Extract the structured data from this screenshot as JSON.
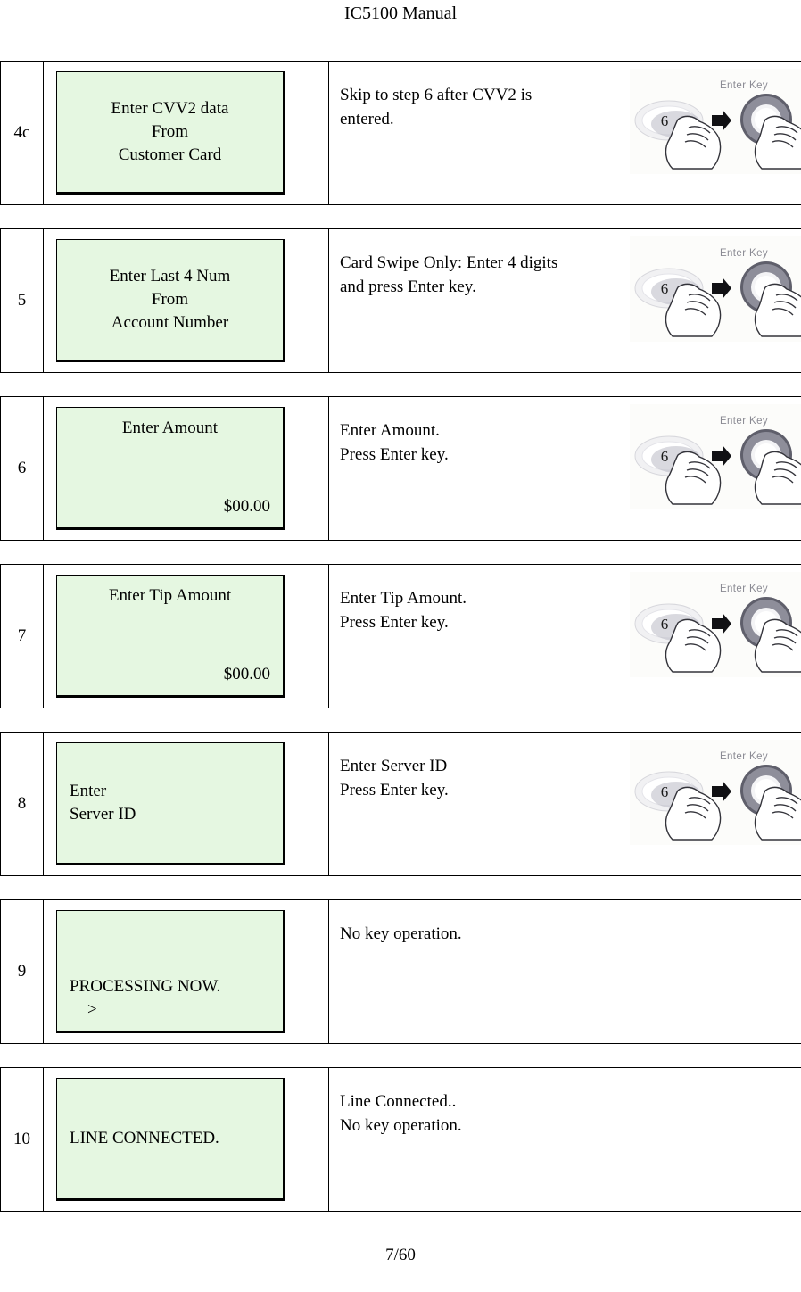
{
  "document": {
    "header_title": "IC5100 Manual",
    "footer_page": "7/60"
  },
  "icon_names": {
    "enter_key_figure": "enter-key-press-illustration",
    "numeric_key": "numeric-key-6-icon",
    "arrow": "right-arrow-icon",
    "enter_ring": "enter-key-ring-icon",
    "hand": "pointing-hand-icon"
  },
  "enter_key_graphic": {
    "label": "Enter Key",
    "key_digit": "6"
  },
  "colors": {
    "lcd_background": "#e5f7e1",
    "lcd_border": "#000000",
    "table_border": "#000000",
    "enter_key_label": "#8a8a93",
    "page_background": "#ffffff"
  },
  "steps": [
    {
      "number": "4c",
      "lcd": {
        "layout": "v-center",
        "lines": [
          {
            "text": "Enter CVV2 data",
            "align": "center"
          },
          {
            "text": "From",
            "align": "center"
          },
          {
            "text": "Customer Card",
            "align": "center"
          }
        ]
      },
      "description_lines": [
        "Skip to step 6 after CVV2 is",
        "entered."
      ],
      "has_enter_key_figure": true
    },
    {
      "number": "5",
      "lcd": {
        "layout": "v-center",
        "lines": [
          {
            "text": "Enter Last 4 Num",
            "align": "center"
          },
          {
            "text": "From",
            "align": "center"
          },
          {
            "text": "Account Number",
            "align": "center"
          }
        ]
      },
      "description_lines": [
        "Card Swipe Only: Enter 4 digits",
        "and press Enter key."
      ],
      "has_enter_key_figure": true
    },
    {
      "number": "6",
      "lcd": {
        "layout": "v-spread",
        "lines": [
          {
            "text": "Enter Amount",
            "align": "center"
          },
          {
            "text": "$00.00",
            "align": "right"
          }
        ]
      },
      "description_lines": [
        "Enter Amount.",
        "Press Enter key."
      ],
      "has_enter_key_figure": true
    },
    {
      "number": "7",
      "lcd": {
        "layout": "v-spread",
        "lines": [
          {
            "text": "Enter Tip Amount",
            "align": "center"
          },
          {
            "text": "$00.00",
            "align": "right"
          }
        ]
      },
      "description_lines": [
        "Enter Tip Amount.",
        "Press Enter key."
      ],
      "has_enter_key_figure": true
    },
    {
      "number": "8",
      "lcd": {
        "layout": "v-center",
        "lines": [
          {
            "text": "Enter",
            "align": "left"
          },
          {
            "text": "Server ID",
            "align": "left"
          }
        ]
      },
      "description_lines": [
        "Enter Server ID",
        "Press Enter key."
      ],
      "has_enter_key_figure": true
    },
    {
      "number": "9",
      "lcd": {
        "layout": "v-bottom",
        "lines": [
          {
            "text": "PROCESSING NOW.",
            "align": "left"
          },
          {
            "text": ">",
            "align": "left",
            "indent": true
          }
        ]
      },
      "description_lines": [
        "No key operation."
      ],
      "has_enter_key_figure": false
    },
    {
      "number": "10",
      "lcd": {
        "layout": "v-center",
        "lines": [
          {
            "text": "LINE CONNECTED.",
            "align": "left"
          }
        ]
      },
      "description_lines": [
        "Line Connected..",
        "No key operation."
      ],
      "has_enter_key_figure": false
    }
  ]
}
